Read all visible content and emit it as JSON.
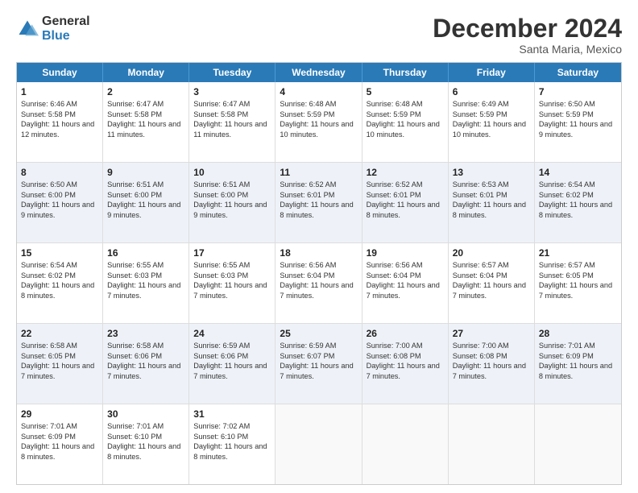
{
  "logo": {
    "general": "General",
    "blue": "Blue"
  },
  "title": "December 2024",
  "subtitle": "Santa Maria, Mexico",
  "days_of_week": [
    "Sunday",
    "Monday",
    "Tuesday",
    "Wednesday",
    "Thursday",
    "Friday",
    "Saturday"
  ],
  "weeks": [
    [
      {
        "day": "1",
        "sunrise": "Sunrise: 6:46 AM",
        "sunset": "Sunset: 5:58 PM",
        "daylight": "Daylight: 11 hours and 12 minutes."
      },
      {
        "day": "2",
        "sunrise": "Sunrise: 6:47 AM",
        "sunset": "Sunset: 5:58 PM",
        "daylight": "Daylight: 11 hours and 11 minutes."
      },
      {
        "day": "3",
        "sunrise": "Sunrise: 6:47 AM",
        "sunset": "Sunset: 5:58 PM",
        "daylight": "Daylight: 11 hours and 11 minutes."
      },
      {
        "day": "4",
        "sunrise": "Sunrise: 6:48 AM",
        "sunset": "Sunset: 5:59 PM",
        "daylight": "Daylight: 11 hours and 10 minutes."
      },
      {
        "day": "5",
        "sunrise": "Sunrise: 6:48 AM",
        "sunset": "Sunset: 5:59 PM",
        "daylight": "Daylight: 11 hours and 10 minutes."
      },
      {
        "day": "6",
        "sunrise": "Sunrise: 6:49 AM",
        "sunset": "Sunset: 5:59 PM",
        "daylight": "Daylight: 11 hours and 10 minutes."
      },
      {
        "day": "7",
        "sunrise": "Sunrise: 6:50 AM",
        "sunset": "Sunset: 5:59 PM",
        "daylight": "Daylight: 11 hours and 9 minutes."
      }
    ],
    [
      {
        "day": "8",
        "sunrise": "Sunrise: 6:50 AM",
        "sunset": "Sunset: 6:00 PM",
        "daylight": "Daylight: 11 hours and 9 minutes."
      },
      {
        "day": "9",
        "sunrise": "Sunrise: 6:51 AM",
        "sunset": "Sunset: 6:00 PM",
        "daylight": "Daylight: 11 hours and 9 minutes."
      },
      {
        "day": "10",
        "sunrise": "Sunrise: 6:51 AM",
        "sunset": "Sunset: 6:00 PM",
        "daylight": "Daylight: 11 hours and 9 minutes."
      },
      {
        "day": "11",
        "sunrise": "Sunrise: 6:52 AM",
        "sunset": "Sunset: 6:01 PM",
        "daylight": "Daylight: 11 hours and 8 minutes."
      },
      {
        "day": "12",
        "sunrise": "Sunrise: 6:52 AM",
        "sunset": "Sunset: 6:01 PM",
        "daylight": "Daylight: 11 hours and 8 minutes."
      },
      {
        "day": "13",
        "sunrise": "Sunrise: 6:53 AM",
        "sunset": "Sunset: 6:01 PM",
        "daylight": "Daylight: 11 hours and 8 minutes."
      },
      {
        "day": "14",
        "sunrise": "Sunrise: 6:54 AM",
        "sunset": "Sunset: 6:02 PM",
        "daylight": "Daylight: 11 hours and 8 minutes."
      }
    ],
    [
      {
        "day": "15",
        "sunrise": "Sunrise: 6:54 AM",
        "sunset": "Sunset: 6:02 PM",
        "daylight": "Daylight: 11 hours and 8 minutes."
      },
      {
        "day": "16",
        "sunrise": "Sunrise: 6:55 AM",
        "sunset": "Sunset: 6:03 PM",
        "daylight": "Daylight: 11 hours and 7 minutes."
      },
      {
        "day": "17",
        "sunrise": "Sunrise: 6:55 AM",
        "sunset": "Sunset: 6:03 PM",
        "daylight": "Daylight: 11 hours and 7 minutes."
      },
      {
        "day": "18",
        "sunrise": "Sunrise: 6:56 AM",
        "sunset": "Sunset: 6:04 PM",
        "daylight": "Daylight: 11 hours and 7 minutes."
      },
      {
        "day": "19",
        "sunrise": "Sunrise: 6:56 AM",
        "sunset": "Sunset: 6:04 PM",
        "daylight": "Daylight: 11 hours and 7 minutes."
      },
      {
        "day": "20",
        "sunrise": "Sunrise: 6:57 AM",
        "sunset": "Sunset: 6:04 PM",
        "daylight": "Daylight: 11 hours and 7 minutes."
      },
      {
        "day": "21",
        "sunrise": "Sunrise: 6:57 AM",
        "sunset": "Sunset: 6:05 PM",
        "daylight": "Daylight: 11 hours and 7 minutes."
      }
    ],
    [
      {
        "day": "22",
        "sunrise": "Sunrise: 6:58 AM",
        "sunset": "Sunset: 6:05 PM",
        "daylight": "Daylight: 11 hours and 7 minutes."
      },
      {
        "day": "23",
        "sunrise": "Sunrise: 6:58 AM",
        "sunset": "Sunset: 6:06 PM",
        "daylight": "Daylight: 11 hours and 7 minutes."
      },
      {
        "day": "24",
        "sunrise": "Sunrise: 6:59 AM",
        "sunset": "Sunset: 6:06 PM",
        "daylight": "Daylight: 11 hours and 7 minutes."
      },
      {
        "day": "25",
        "sunrise": "Sunrise: 6:59 AM",
        "sunset": "Sunset: 6:07 PM",
        "daylight": "Daylight: 11 hours and 7 minutes."
      },
      {
        "day": "26",
        "sunrise": "Sunrise: 7:00 AM",
        "sunset": "Sunset: 6:08 PM",
        "daylight": "Daylight: 11 hours and 7 minutes."
      },
      {
        "day": "27",
        "sunrise": "Sunrise: 7:00 AM",
        "sunset": "Sunset: 6:08 PM",
        "daylight": "Daylight: 11 hours and 7 minutes."
      },
      {
        "day": "28",
        "sunrise": "Sunrise: 7:01 AM",
        "sunset": "Sunset: 6:09 PM",
        "daylight": "Daylight: 11 hours and 8 minutes."
      }
    ],
    [
      {
        "day": "29",
        "sunrise": "Sunrise: 7:01 AM",
        "sunset": "Sunset: 6:09 PM",
        "daylight": "Daylight: 11 hours and 8 minutes."
      },
      {
        "day": "30",
        "sunrise": "Sunrise: 7:01 AM",
        "sunset": "Sunset: 6:10 PM",
        "daylight": "Daylight: 11 hours and 8 minutes."
      },
      {
        "day": "31",
        "sunrise": "Sunrise: 7:02 AM",
        "sunset": "Sunset: 6:10 PM",
        "daylight": "Daylight: 11 hours and 8 minutes."
      },
      null,
      null,
      null,
      null
    ]
  ]
}
